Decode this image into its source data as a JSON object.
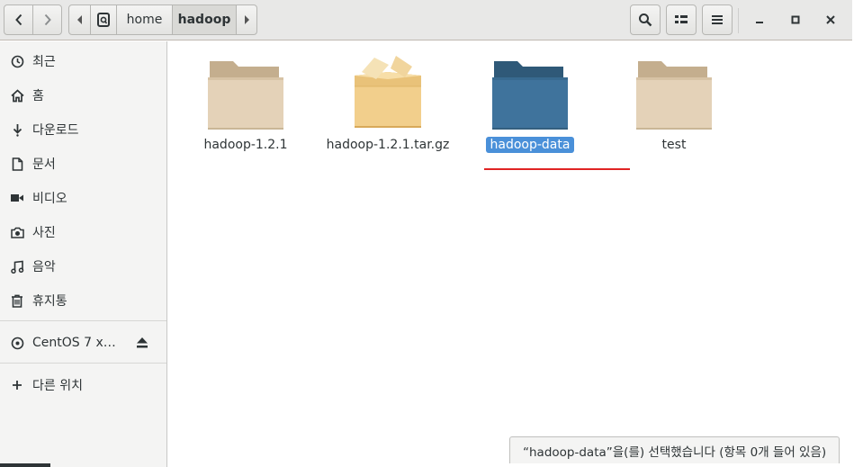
{
  "path": {
    "home": "home",
    "current": "hadoop"
  },
  "sidebar": {
    "items": [
      {
        "label": "최근",
        "icon": "clock-icon"
      },
      {
        "label": "홈",
        "icon": "home-icon"
      },
      {
        "label": "다운로드",
        "icon": "download-icon"
      },
      {
        "label": "문서",
        "icon": "document-icon"
      },
      {
        "label": "비디오",
        "icon": "video-icon"
      },
      {
        "label": "사진",
        "icon": "camera-icon"
      },
      {
        "label": "음악",
        "icon": "music-icon"
      },
      {
        "label": "휴지통",
        "icon": "trash-icon"
      }
    ],
    "device": {
      "label": "CentOS 7 x…",
      "icon": "disc-icon"
    },
    "other": {
      "label": "다른 위치",
      "icon": "plus-icon"
    }
  },
  "files": [
    {
      "name": "hadoop-1.2.1",
      "kind": "folder",
      "selected": false
    },
    {
      "name": "hadoop-1.2.1.tar.gz",
      "kind": "archive",
      "selected": false
    },
    {
      "name": "hadoop-data",
      "kind": "folder",
      "selected": true
    },
    {
      "name": "test",
      "kind": "folder",
      "selected": false
    }
  ],
  "status": "“hadoop-data”을(를) 선택했습니다 (항목 0개 들어 있음)",
  "colors": {
    "selection": "#4a90d9",
    "folder": "#e4d2b8",
    "folder_tab": "#c4ae8e",
    "selected_folder": "#3f739c",
    "selected_folder_tab": "#2f5978",
    "annotation_line": "#e02424"
  }
}
